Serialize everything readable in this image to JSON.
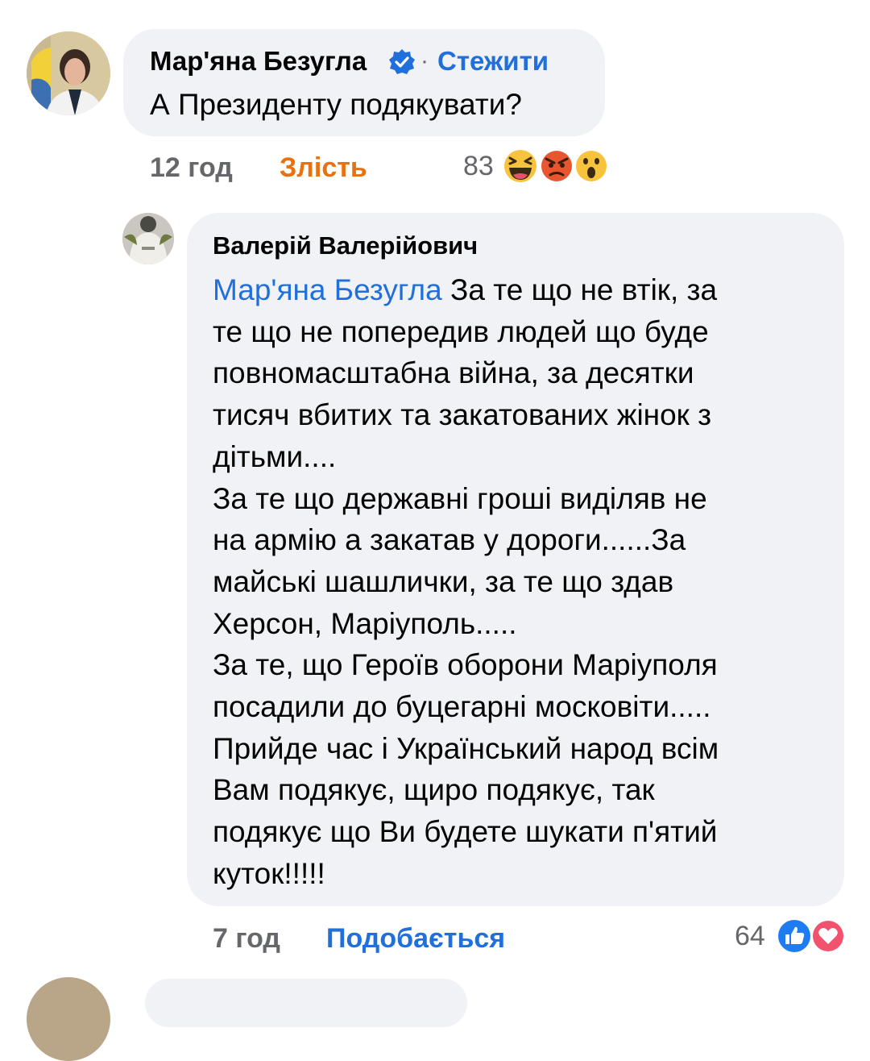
{
  "comments": [
    {
      "author": "Мар'яна Безугла",
      "follow_label": "Стежити",
      "separator": "·",
      "text": "А Президенту подякувати?",
      "time": "12 год",
      "reaction_label": "Злість",
      "reaction_count": "83",
      "reaction_icons": [
        "laughing-emoji-icon",
        "angry-emoji-icon",
        "wow-emoji-icon"
      ],
      "verified": true
    },
    {
      "author": "Валерій Валерійович",
      "mention": "Мар'яна Безугла",
      "text_lines": [
        " За те що не втік, за",
        "те що не попередив людей що буде",
        "повномасштабна війна, за десятки",
        "тисяч вбитих та закатованих жінок з",
        "дітьми....",
        "За те що державні гроші виділяв не",
        "на армію а закатав у дороги......За",
        "майські шашлички, за те що здав",
        "Херсон, Маріуполь.....",
        "За те, що Героїв оборони Маріуполя",
        "посадили до буцегарні московіти.....",
        "Прийде час і Український народ всім",
        "Вам подякує, щиро подякує, так",
        "подякує що Ви будете шукати п'ятий",
        "куток!!!!!"
      ],
      "time": "7 год",
      "reaction_label": "Подобається",
      "reaction_count": "64",
      "reaction_icons": [
        "like-icon",
        "love-icon"
      ]
    }
  ],
  "colors": {
    "bubble": "#f0f2f5",
    "link_blue": "#216fdb",
    "angry_orange": "#e9710f",
    "meta_gray": "#65676b"
  }
}
